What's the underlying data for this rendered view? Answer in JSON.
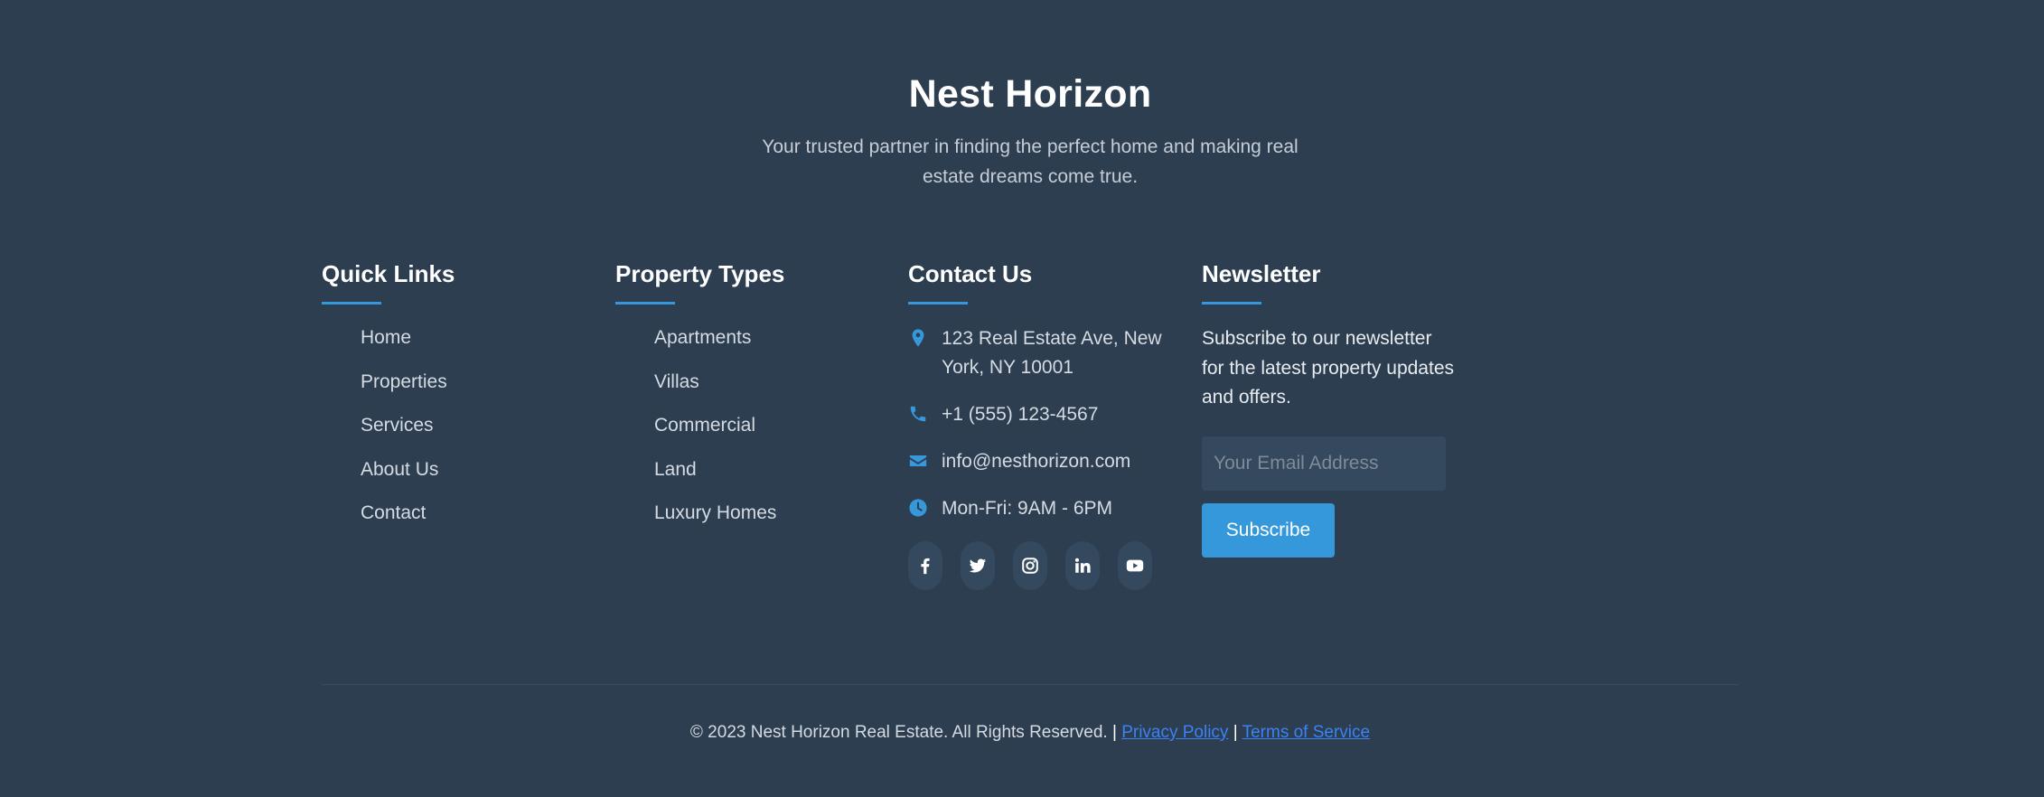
{
  "brand": {
    "name": "Nest Horizon",
    "tagline": "Your trusted partner in finding the perfect home and making real estate dreams come true."
  },
  "quick_links": {
    "title": "Quick Links",
    "items": [
      "Home",
      "Properties",
      "Services",
      "About Us",
      "Contact"
    ]
  },
  "property_types": {
    "title": "Property Types",
    "items": [
      "Apartments",
      "Villas",
      "Commercial",
      "Land",
      "Luxury Homes"
    ]
  },
  "contact": {
    "title": "Contact Us",
    "address": "123 Real Estate Ave, New York, NY 10001",
    "phone": "+1 (555) 123-4567",
    "email": "info@nesthorizon.com",
    "hours": "Mon-Fri: 9AM - 6PM",
    "icons": [
      "map-marker-icon",
      "phone-icon",
      "envelope-icon",
      "clock-icon"
    ],
    "social": [
      "facebook-icon",
      "twitter-icon",
      "instagram-icon",
      "linkedin-icon",
      "youtube-icon"
    ]
  },
  "newsletter": {
    "title": "Newsletter",
    "text": "Subscribe to our newsletter for the latest property updates and offers.",
    "email_placeholder": "Your Email Address",
    "email_value": "",
    "button_label": "Subscribe"
  },
  "bottom": {
    "copyright": "© 2023 Nest Horizon Real Estate. All Rights Reserved.",
    "separator": "|",
    "privacy_label": "Privacy Policy",
    "terms_label": "Terms of Service"
  },
  "colors": {
    "background": "#2d3e50",
    "accent": "#3498db",
    "link": "#3b82f6",
    "social_bg": "#34495e"
  }
}
